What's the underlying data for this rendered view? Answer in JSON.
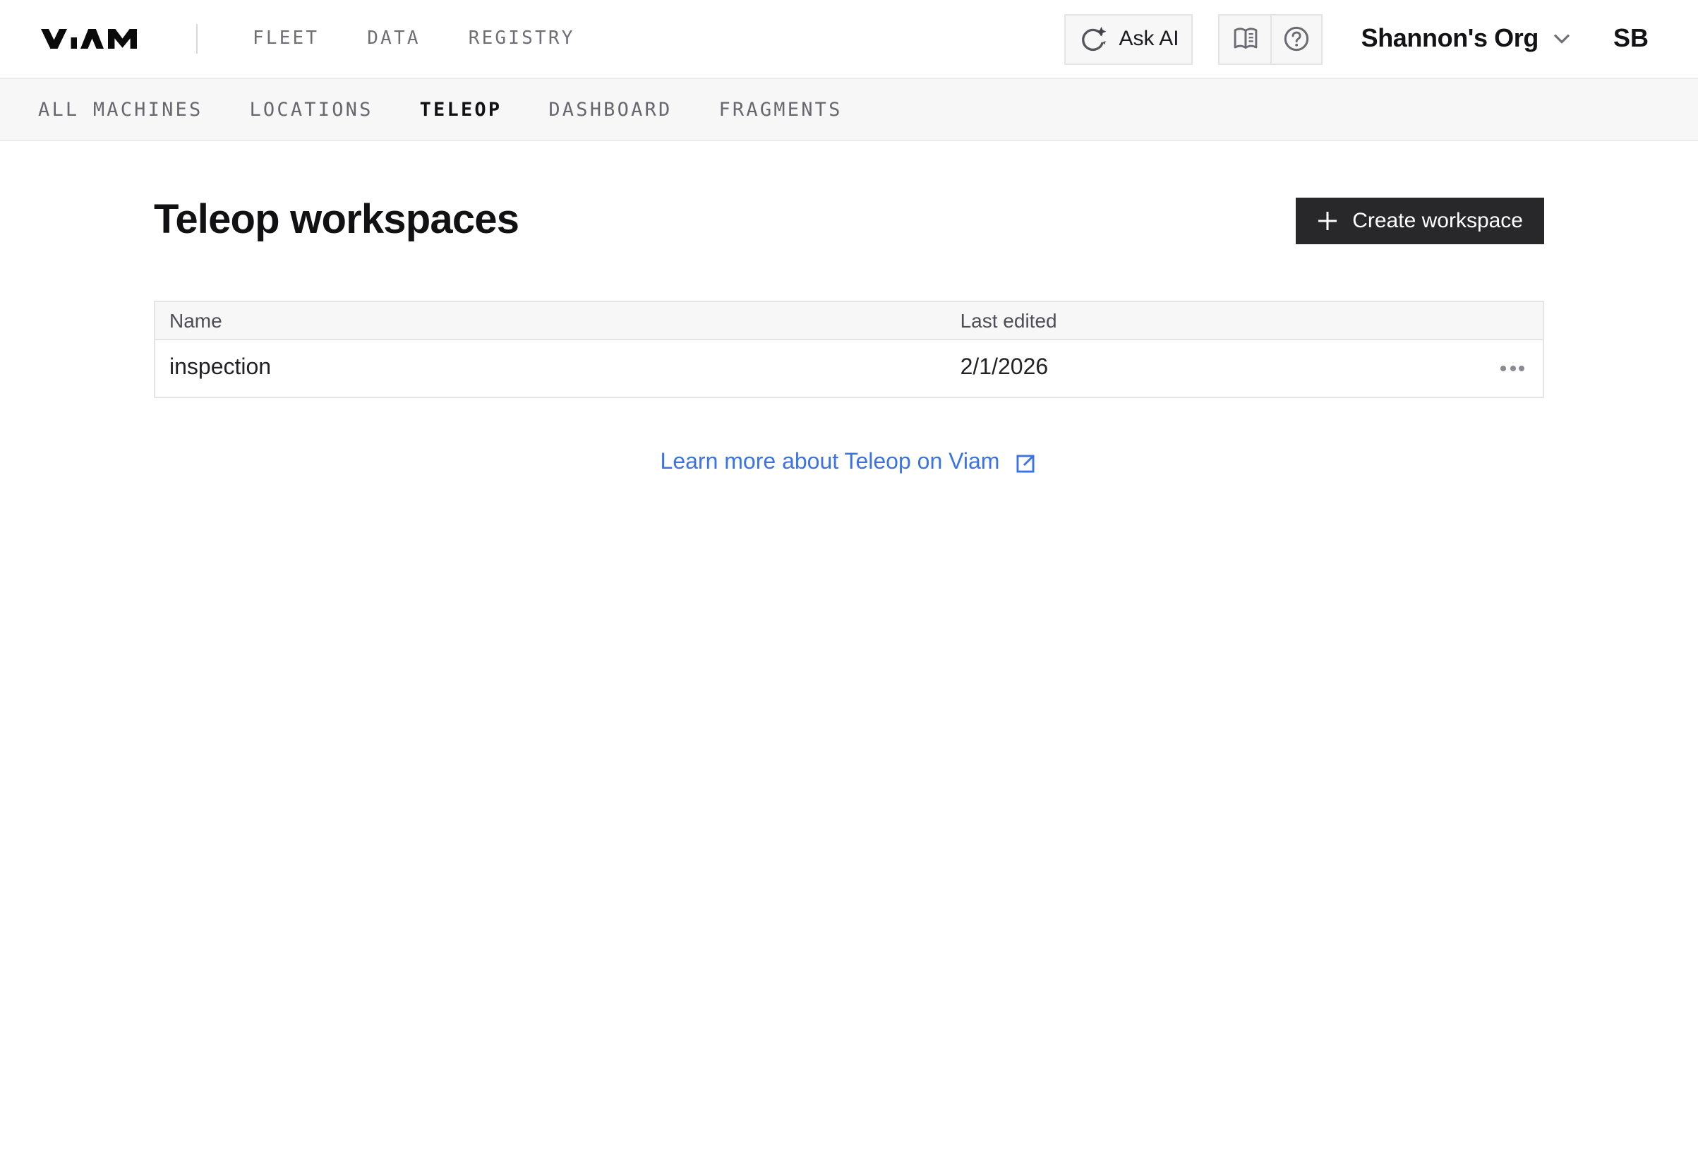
{
  "header": {
    "logo": "VIAM",
    "nav_items": [
      {
        "label": "FLEET"
      },
      {
        "label": "DATA"
      },
      {
        "label": "REGISTRY"
      }
    ],
    "ask_ai": {
      "label": "Ask AI",
      "icon": "ai-refresh-sparkle-icon"
    },
    "help_icons": [
      "docs-book-icon",
      "help-circle-icon"
    ],
    "org": {
      "name": "Shannon's Org",
      "icon": "chevron-down-icon"
    },
    "avatar": {
      "initials": "SB"
    }
  },
  "subnav": {
    "items": [
      {
        "label": "ALL MACHINES",
        "active": false
      },
      {
        "label": "LOCATIONS",
        "active": false
      },
      {
        "label": "TELEOP",
        "active": true
      },
      {
        "label": "DASHBOARD",
        "active": false
      },
      {
        "label": "FRAGMENTS",
        "active": false
      }
    ]
  },
  "main": {
    "title": "Teleop workspaces",
    "create_button": {
      "label": "Create workspace",
      "icon": "plus-icon"
    },
    "table": {
      "columns": [
        "Name",
        "Last edited"
      ],
      "rows": [
        {
          "name": "inspection",
          "last_edited": "2/1/2026"
        }
      ]
    },
    "footer_link": {
      "label": "Learn more about Teleop on Viam",
      "icon": "external-link-icon"
    }
  },
  "colors": {
    "link_blue": "#3b73e6",
    "button_dark": "#28282b",
    "band_bg": "#f7f7f8",
    "border": "#e4e4e7",
    "nav_gray": "#6e6e74"
  }
}
